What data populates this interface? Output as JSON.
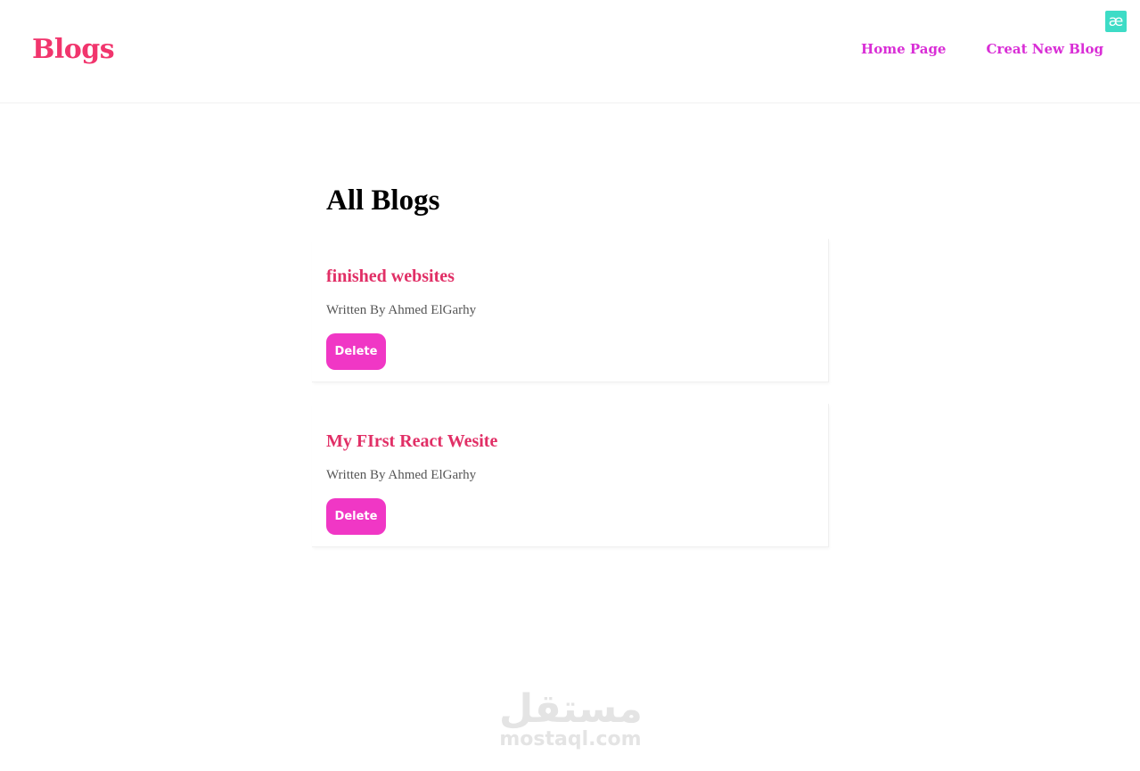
{
  "navbar": {
    "brand": "Blogs",
    "links": [
      "Home Page",
      "Creat New Blog"
    ],
    "extension_icon": "æ"
  },
  "main": {
    "heading": "All Blogs",
    "blogs": [
      {
        "title": "finished websites",
        "author": "Written By Ahmed ElGarhy",
        "delete_label": "Delete"
      },
      {
        "title": "My FIrst React Wesite",
        "author": "Written By Ahmed ElGarhy",
        "delete_label": "Delete"
      }
    ]
  },
  "watermark": {
    "arabic": "مستقل",
    "latin": "mostaql.com"
  },
  "colors": {
    "brand": "#f1356d",
    "nav_link": "#d92ed6",
    "blog_title": "#e12f66",
    "delete_button": "#f037c5",
    "extension_badge": "#3ddcc6"
  }
}
